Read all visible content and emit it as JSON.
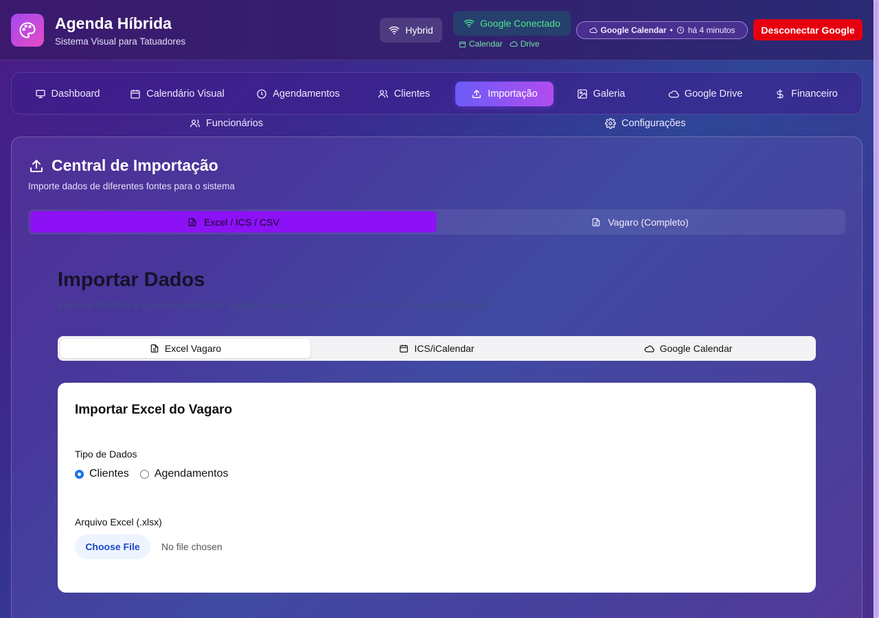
{
  "header": {
    "title": "Agenda Híbrida",
    "subtitle": "Sistema Visual para Tatuadores",
    "mode_label": "Hybrid",
    "google_status": "Google Conectado",
    "google_services": [
      "Calendar",
      "Drive"
    ],
    "calendar_pill": {
      "name": "Google Calendar",
      "separator": "•",
      "time": "há 4 minutos"
    },
    "disconnect_label": "Desconectar Google"
  },
  "nav": {
    "items": [
      {
        "label": "Dashboard",
        "icon": "monitor-icon"
      },
      {
        "label": "Calendário Visual",
        "icon": "calendar-icon"
      },
      {
        "label": "Agendamentos",
        "icon": "clock-icon"
      },
      {
        "label": "Clientes",
        "icon": "users-icon"
      },
      {
        "label": "Importação",
        "icon": "upload-icon",
        "active": true
      },
      {
        "label": "Galeria",
        "icon": "image-icon"
      },
      {
        "label": "Google Drive",
        "icon": "cloud-icon"
      },
      {
        "label": "Financeiro",
        "icon": "dollar-icon"
      },
      {
        "label": "Funcionários",
        "icon": "users-icon"
      },
      {
        "label": "Configurações",
        "icon": "gear-icon"
      }
    ]
  },
  "main": {
    "title": "Central de Importação",
    "subtitle": "Importe dados de diferentes fontes para o sistema",
    "tabs": [
      {
        "label": "Excel / ICS / CSV",
        "active": true
      },
      {
        "label": "Vagaro (Completo)",
        "active": false
      }
    ]
  },
  "import": {
    "title": "Importar Dados",
    "subtitle": "Importe clientes e agendamentos do Vagaro, arquivos ICS ou sincronize com Google Calendar",
    "tabs": [
      {
        "label": "Excel Vagaro",
        "active": true
      },
      {
        "label": "ICS/iCalendar",
        "active": false
      },
      {
        "label": "Google Calendar",
        "active": false
      }
    ],
    "card": {
      "title": "Importar Excel do Vagaro",
      "type_label": "Tipo de Dados",
      "options": [
        {
          "label": "Clientes",
          "checked": true
        },
        {
          "label": "Agendamentos",
          "checked": false
        }
      ],
      "file_label": "Arquivo Excel (.xlsx)",
      "choose_file": "Choose File",
      "no_file": "No file chosen"
    }
  },
  "colors": {
    "accent_active_tab": "#8c12f5",
    "disconnect_button": "#e6000f",
    "google_connected": "#4ee68d"
  }
}
